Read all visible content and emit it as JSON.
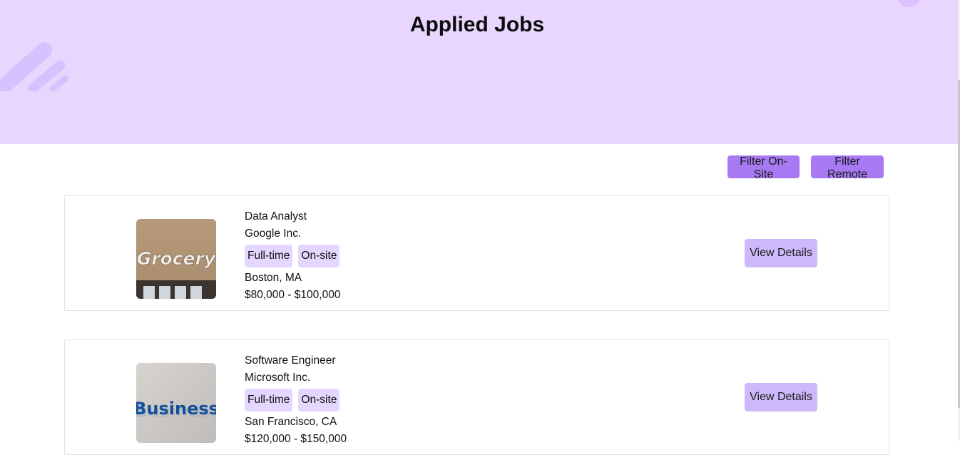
{
  "header": {
    "title": "Applied Jobs"
  },
  "filters": {
    "on_site": "Filter On-Site",
    "remote": "Filter Remote"
  },
  "jobs": [
    {
      "title": "Data Analyst",
      "company": "Google Inc.",
      "tags": [
        "Full-time",
        "On-site"
      ],
      "location": "Boston, MA",
      "salary": "$80,000 - $100,000",
      "image_text": "Grocery",
      "button": "View Details"
    },
    {
      "title": "Software Engineer",
      "company": "Microsoft Inc.",
      "tags": [
        "Full-time",
        "On-site"
      ],
      "location": "San Francisco, CA",
      "salary": "$120,000 - $150,000",
      "image_text": "Business",
      "button": "View Details"
    }
  ],
  "colors": {
    "hero_bg": "#e8d6ff",
    "filter_button": "#a779f3",
    "view_button": "#cdb8fb",
    "tag_bg": "#e4d6ff"
  }
}
